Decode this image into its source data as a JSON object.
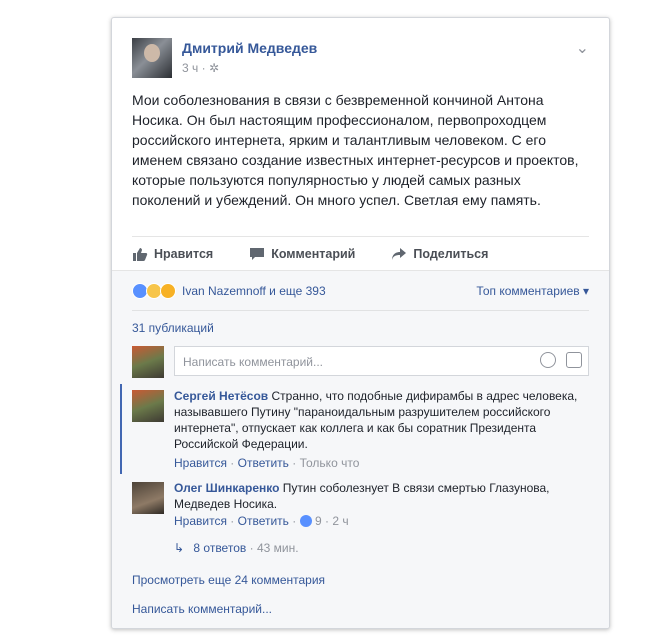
{
  "post": {
    "author": "Дмитрий Медведев",
    "time": "3 ч",
    "text": "Мои соболезнования в связи с безвременной кончиной Антона Носика. Он был настоящим профессионалом, первопроходцем российского интернета, ярким и талантливым человеком. С его именем связано создание известных интернет-ресурсов и проектов, которые пользуются популярностью у людей самых разных поколений и убеждений. Он много успел. Светлая ему память."
  },
  "actions": {
    "like": "Нравится",
    "comment": "Комментарий",
    "share": "Поделиться"
  },
  "reactions": {
    "names": "Ivan Nazemnoff и еще 393",
    "sort": "Топ комментариев"
  },
  "publications": "31 публикаций",
  "comment_box": {
    "placeholder": "Написать комментарий..."
  },
  "comments": [
    {
      "name": "Сергей Нетёсов",
      "text": "Странно, что подобные дифирамбы в адрес человека, называвшего Путину \"параноидальным разрушителем российского интернета\", отпускает как коллега и как бы соратник Президента Российской Федерации.",
      "like": "Нравится",
      "reply": "Ответить",
      "time": "Только что"
    },
    {
      "name": "Олег Шинкаренко",
      "text": "Путин соболезнует В связи смертью Глазунова, Медведев Носика.",
      "like": "Нравится",
      "reply": "Ответить",
      "likes_count": "9",
      "time": "2 ч"
    }
  ],
  "replies": {
    "label": "8 ответов",
    "time": "43 мин."
  },
  "view_more": "Просмотреть еще 24 комментария",
  "write_comment": "Написать комментарий...",
  "colors": {
    "link": "#365899",
    "accent": "#4267b2",
    "muted": "#90949c"
  }
}
